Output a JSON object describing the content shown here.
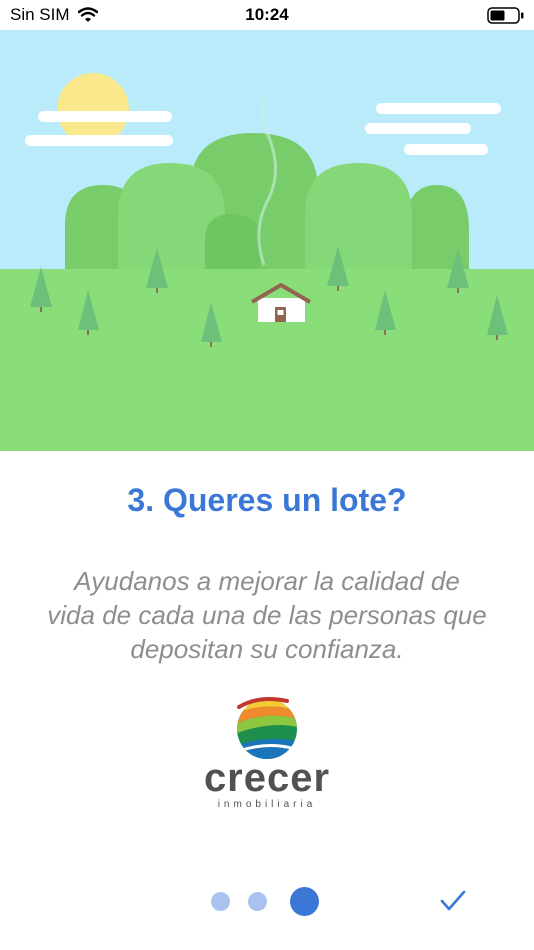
{
  "status_bar": {
    "carrier": "Sin SIM",
    "time": "10:24",
    "icons": [
      "wifi-icon",
      "battery-icon"
    ]
  },
  "illustration": {
    "description_icons": [
      "sun-icon",
      "cloud-icon",
      "hills",
      "trees",
      "house-icon"
    ],
    "colors": {
      "sky": "#b9ebfb",
      "grass": "#8ade79",
      "hill_back": "#78cd6a",
      "hill_front": "#85d877",
      "tree": "#6dc07a",
      "sun": "#fae88d",
      "cloud": "#ffffff"
    }
  },
  "slide": {
    "title": "3. Queres un lote?",
    "text_lines": [
      "Ayudanos a mejorar la calidad de",
      "vida de cada una de las personas que",
      "depositan su confianza."
    ]
  },
  "logo": {
    "name": "crecer",
    "subtitle": "inmobiliaria"
  },
  "pagination": {
    "total": 3,
    "current": 3,
    "active_color": "#3a77d6",
    "inactive_color": "#a9c2ef"
  },
  "done_icon": "checkmark-icon",
  "accent_color": "#3a77d6"
}
